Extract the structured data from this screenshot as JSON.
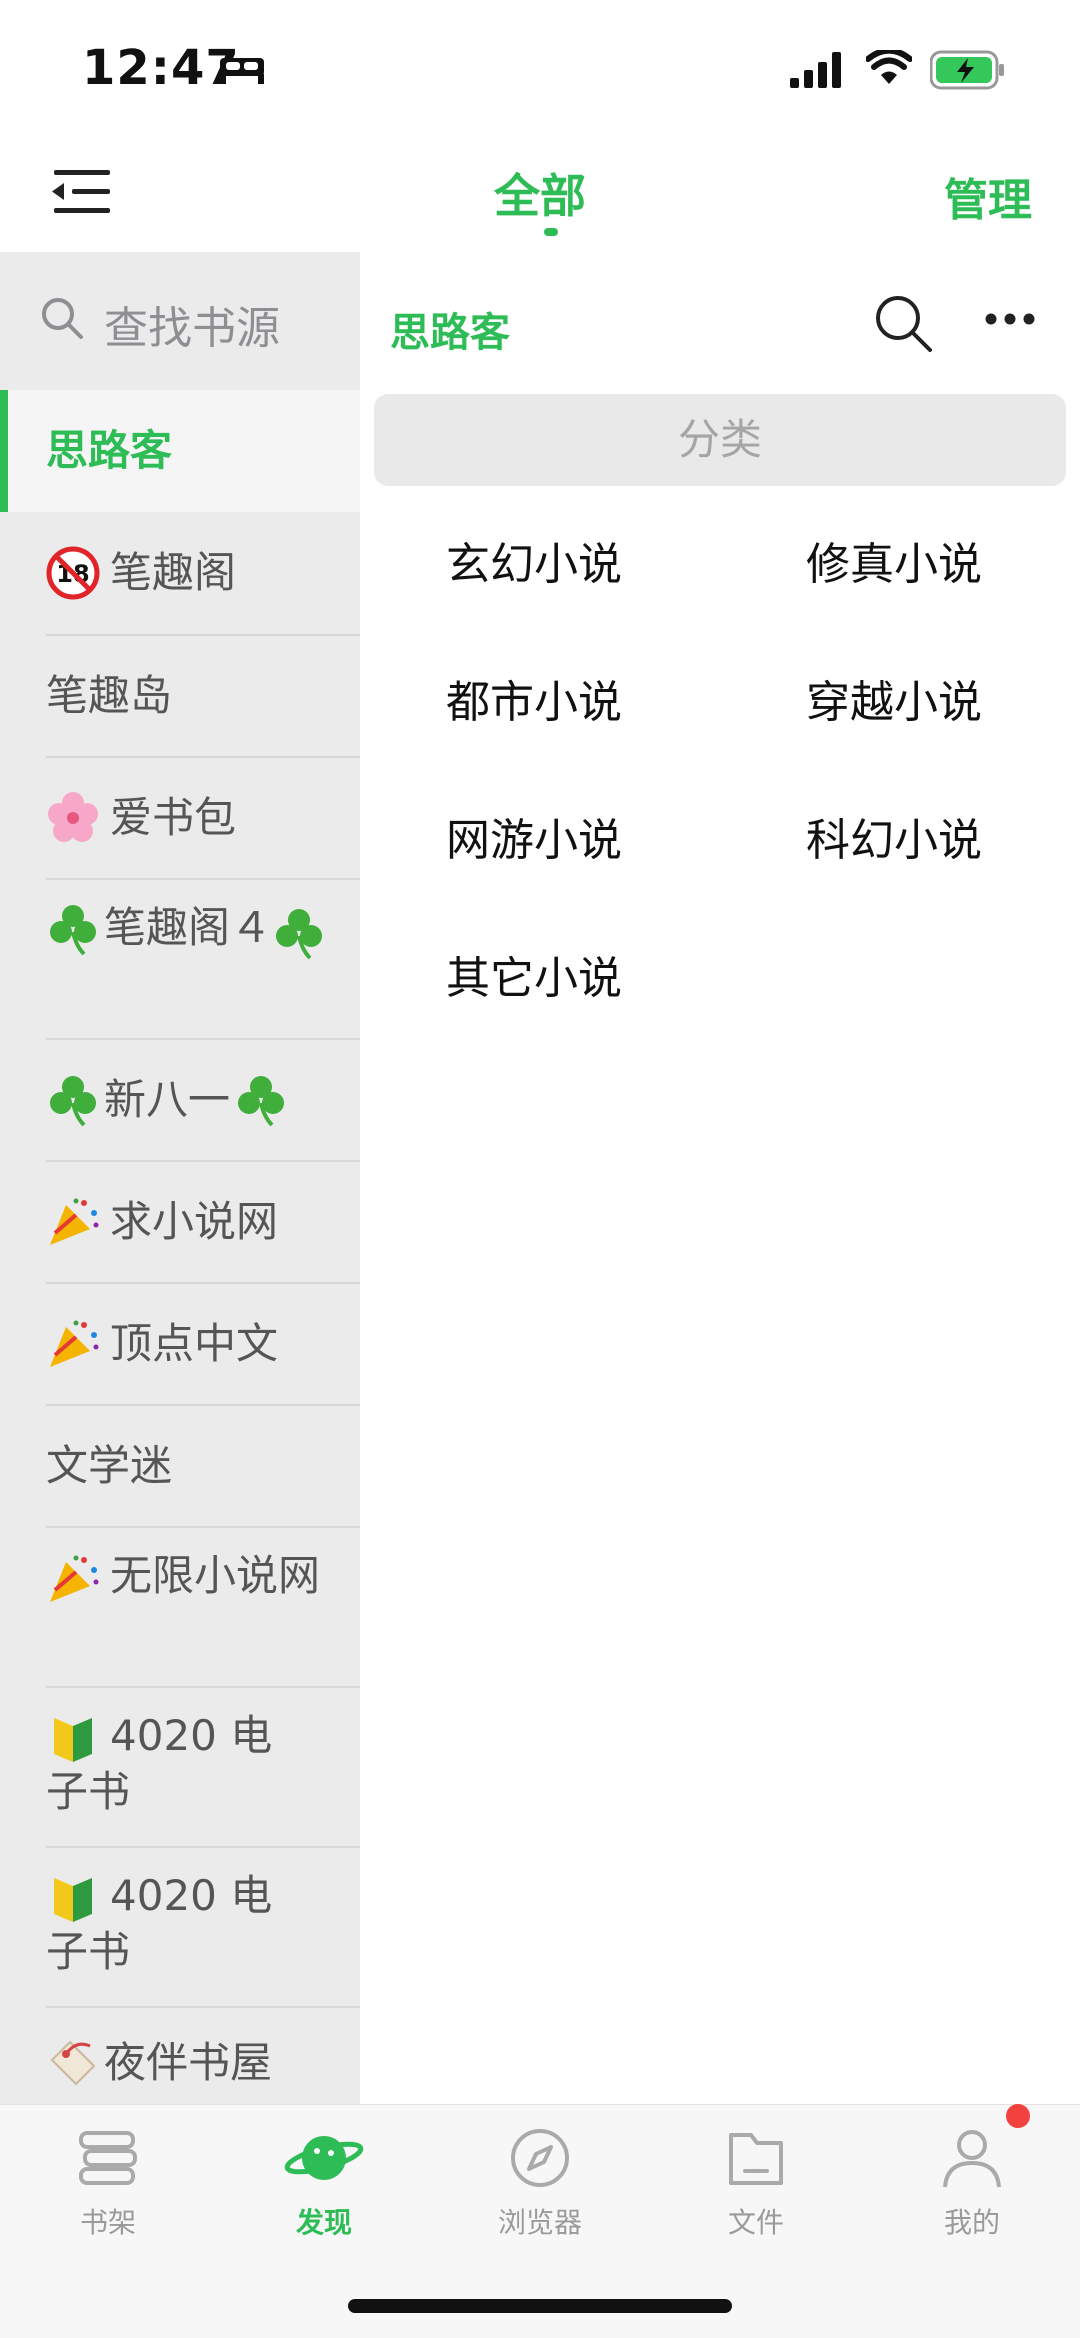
{
  "status_bar": {
    "time": "12:47"
  },
  "nav": {
    "title": "全部",
    "manage": "管理"
  },
  "sidebar": {
    "search_placeholder": "查找书源",
    "active": "思路客",
    "items": [
      {
        "emoji": "18-icon",
        "label": "笔趣阁"
      },
      {
        "emoji": "",
        "label": "笔趣岛"
      },
      {
        "emoji": "cherry-blossom-icon",
        "label": "爱书包"
      },
      {
        "emoji": "shamrock-icon",
        "label": "笔趣阁４",
        "suffix_emoji": "shamrock-icon"
      },
      {
        "emoji": "shamrock-icon",
        "label": "新八一",
        "suffix_emoji": "shamrock-icon"
      },
      {
        "emoji": "party-popper-icon",
        "label": "求小说网"
      },
      {
        "emoji": "party-popper-icon",
        "label": "顶点中文"
      },
      {
        "emoji": "",
        "label": "文学迷"
      },
      {
        "emoji": "party-popper-icon",
        "label": "无限小说网"
      },
      {
        "emoji": "beginner-icon",
        "label": "4020 电子书"
      },
      {
        "emoji": "beginner-icon",
        "label": "4020 电子书"
      },
      {
        "emoji": "tag-icon",
        "label": "夜伴书屋"
      }
    ]
  },
  "panel": {
    "title": "思路客",
    "section": "分类",
    "categories": [
      "玄幻小说",
      "修真小说",
      "都市小说",
      "穿越小说",
      "网游小说",
      "科幻小说",
      "其它小说"
    ]
  },
  "tabbar": {
    "tabs": [
      {
        "label": "书架",
        "icon": "bookshelf-icon"
      },
      {
        "label": "发现",
        "icon": "planet-icon"
      },
      {
        "label": "浏览器",
        "icon": "compass-icon"
      },
      {
        "label": "文件",
        "icon": "folder-icon"
      },
      {
        "label": "我的",
        "icon": "person-icon"
      }
    ],
    "active_index": 1
  },
  "colors": {
    "accent": "#2dbc55",
    "badge": "#f2413e",
    "sidebar_bg": "#ebebeb"
  }
}
